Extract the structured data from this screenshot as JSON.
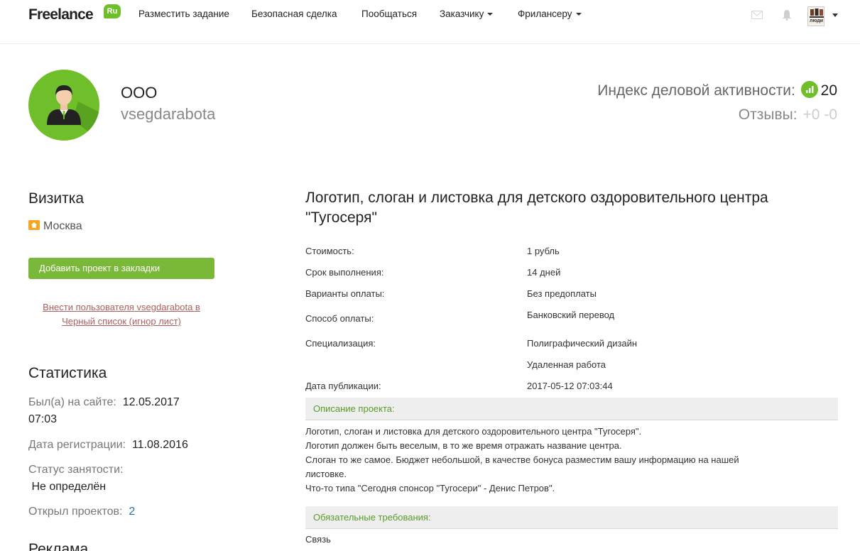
{
  "nav": {
    "logo_text": "Freelance",
    "logo_badge": "Ru",
    "items": [
      "Разместить задание",
      "Безопасная сделка",
      "Пообщаться",
      "Заказчику",
      "Фрилансеру"
    ],
    "avatar_text": "люди"
  },
  "profile": {
    "name": "ООО",
    "login": "vsegdarabota",
    "activity_label": "Индекс деловой активности:",
    "activity_value": "20",
    "reviews_label": "Отзывы:",
    "reviews_value": "+0 -0"
  },
  "sidebar": {
    "card_heading": "Визитка",
    "city": "Москва",
    "bookmark_button": "Добавить проект в закладки",
    "blacklist_line1": "Внести пользователя vsegdarabota в",
    "blacklist_line2": "Черный список (игнор лист)",
    "stats_heading": "Статистика",
    "last_seen_label": "Был(а) на сайте:",
    "last_seen_date": "12.05.2017",
    "last_seen_time": "07:03",
    "reg_label": "Дата регистрации:",
    "reg_value": "11.08.2016",
    "status_label": "Статус занятости:",
    "status_value": "Не определён",
    "projects_label": "Открыл проектов:",
    "projects_value": "2",
    "ads_heading": "Реклама"
  },
  "project": {
    "title": "Логотип, слоган и листовка для детского оздоровительного центра \"Тугосеря\"",
    "rows": [
      {
        "label": "Стоимость:",
        "value": "1 рубль"
      },
      {
        "label": "Срок выполнения:",
        "value": "14 дней"
      },
      {
        "label": "Варианты оплаты:",
        "value": "Без предоплаты"
      },
      {
        "label": "Способ оплаты:",
        "value": "Банковский перевод"
      },
      {
        "label": "Специализация:",
        "value": "Полиграфический дизайн"
      },
      {
        "label": "",
        "value": "Удаленная работа"
      },
      {
        "label": "Дата публикации:",
        "value": "2017-05-12 07:03:44"
      }
    ],
    "description_heading": "Описание проекта:",
    "description_lines": [
      "Логотип, слоган и листовка для детского оздоровительного центра \"Тугосеря\".",
      "Логотип должен быть веселым, в то же время отражать название центра.",
      "Слоган то же самое. Бюджет небольшой, в качестве бонуса разместим вашу информацию на нашей",
      "листовке.",
      "Что-то типа \"Сегодня спонсор \"Тугосери\" - Денис Петров\"."
    ],
    "requirements_heading": "Обязательные требования:",
    "requirements_first": "Связь"
  },
  "colors": {
    "brand_green": "#6fbf2a",
    "button_green": "#7ab839",
    "link_red": "#b15d5d",
    "link_blue": "#2d6ea8"
  },
  "icons": [
    "mail-icon",
    "bell-icon",
    "home-icon",
    "signal-icon",
    "chevron-down-icon"
  ]
}
